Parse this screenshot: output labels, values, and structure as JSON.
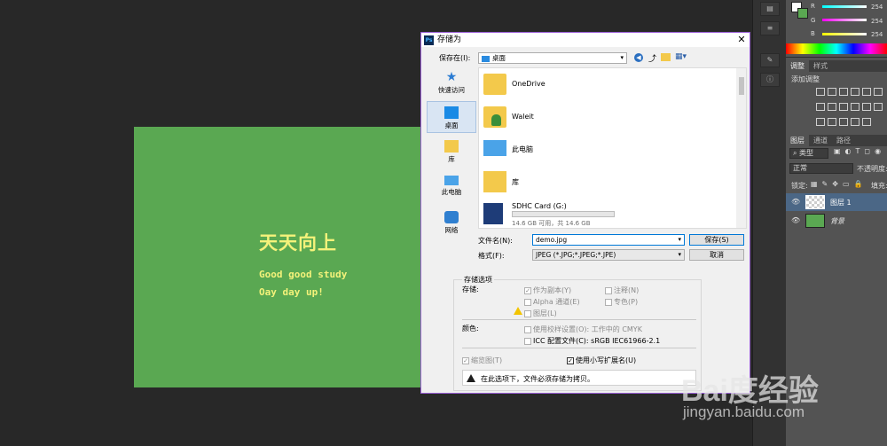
{
  "canvas": {
    "title": "天天向上",
    "line1": "Good good study",
    "line2": "Oay day up!",
    "bg": "#5aa852",
    "text_color": "#f4f27a"
  },
  "dialog": {
    "title": "存储为",
    "app_icon": "Ps",
    "save_in_label": "保存在(I):",
    "save_in_value": "桌面",
    "nav": [
      "快速访问",
      "桌面",
      "库",
      "此电脑",
      "网络"
    ],
    "files": [
      {
        "name": "OneDrive",
        "icon": "folder-icon"
      },
      {
        "name": "Waleit",
        "icon": "user-folder-icon"
      },
      {
        "name": "此电脑",
        "icon": "computer-icon"
      },
      {
        "name": "库",
        "icon": "library-icon"
      },
      {
        "name": "SDHC Card (G:)",
        "icon": "sd-card-icon",
        "detail": "14.6 GB 可用，共 14.6 GB"
      }
    ],
    "filename_label": "文件名(N):",
    "filename_value": "demo.jpg",
    "format_label": "格式(F):",
    "format_value": "JPEG (*.JPG;*.JPEG;*.JPE)",
    "save_button": "保存(S)",
    "cancel_button": "取消",
    "options_title": "存储选项",
    "save_label": "存储:",
    "opt_copy": "作为副本(Y)",
    "opt_notes": "注释(N)",
    "opt_alpha": "Alpha 通道(E)",
    "opt_spot": "专色(P)",
    "opt_layers": "图层(L)",
    "color_label": "颜色:",
    "opt_proof": "使用校样设置(O):",
    "opt_proof_value": "工作中的 CMYK",
    "opt_icc": "ICC 配置文件(C):",
    "opt_icc_value": "sRGB IEC61966-2.1",
    "opt_thumb": "缩览图(T)",
    "opt_lowercase": "使用小写扩展名(U)",
    "warning_text": "在此选项下，文件必须存储为拷贝。"
  },
  "panels": {
    "rgb": [
      {
        "label": "R",
        "value": "254",
        "color": "#e04040"
      },
      {
        "label": "G",
        "value": "254",
        "color": "#40c040"
      },
      {
        "label": "B",
        "value": "254",
        "color": "#4060e0"
      }
    ],
    "adjust_tabs": [
      "调整",
      "样式"
    ],
    "adjust_title": "添加调整",
    "layer_tabs": [
      "图层",
      "通道",
      "路径"
    ],
    "kind_filter": "类型",
    "blend_mode": "正常",
    "opacity_label": "不透明度:",
    "lock_label": "锁定:",
    "fill_label": "填充:",
    "layers": [
      {
        "name": "图层 1"
      },
      {
        "name": "背景"
      }
    ]
  },
  "watermark": {
    "logo": "Bai度经验",
    "url": "jingyan.baidu.com"
  }
}
